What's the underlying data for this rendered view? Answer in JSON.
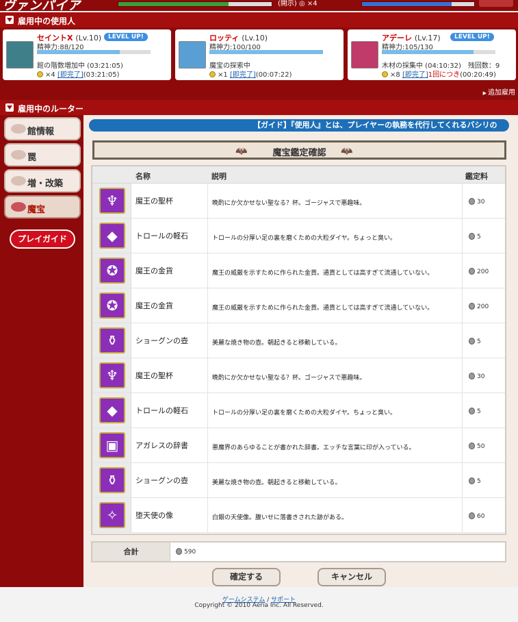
{
  "topbar": {
    "logo": "ヴァンパイア",
    "middle_text": "(開示) ◎ ×4"
  },
  "servants_header": {
    "title": "雇用中の使用人"
  },
  "servants": [
    {
      "name": "セイントX",
      "level": "(Lv.10)",
      "level_up": "LEVEL UP!",
      "stamina": "精神力:88/120",
      "stamina_ratio": 0.73,
      "task": "館の階数増加中 (03:21:05)",
      "coins": "×4",
      "complete": "[即完了]",
      "time": "(03:21:05)",
      "extra": "",
      "extra_red": "",
      "extra_time": "",
      "portrait_color": "#3f7f8a"
    },
    {
      "name": "ロッティ",
      "level": "(Lv.10)",
      "level_up": "",
      "stamina": "精神力:100/100",
      "stamina_ratio": 1.0,
      "task": "魔宝の探索中",
      "coins": "×1",
      "complete": "[即完了]",
      "time": "(00:07:22)",
      "extra": "",
      "extra_red": "",
      "extra_time": "",
      "portrait_color": "#5a9fd4"
    },
    {
      "name": "アデーレ",
      "level": "(Lv.17)",
      "level_up": "LEVEL UP!",
      "stamina": "精神力:105/130",
      "stamina_ratio": 0.81,
      "task": "木材の採集中 (04:10:32)　残回数：9",
      "coins": "×8",
      "complete": "[即完了]",
      "time": "",
      "extra": "",
      "extra_red": "1回につき",
      "extra_time": "(00:20:49)",
      "portrait_color": "#c03a6a"
    }
  ],
  "add_hire": "追加雇用",
  "looter_header": {
    "title": "雇用中のルーター"
  },
  "nav": [
    {
      "label": "館情報",
      "active": false
    },
    {
      "label": "罠",
      "active": false
    },
    {
      "label": "増・改築",
      "active": false
    },
    {
      "label": "魔宝",
      "active": true
    }
  ],
  "play_guide": "プレイガイド",
  "marquee": "【ガイド】『使用人』とは、プレイヤーの執務を代行してくれるバシリの",
  "panel_title": "魔宝鑑定確認",
  "table": {
    "headers": {
      "name": "名称",
      "desc": "説明",
      "fee": "鑑定料"
    },
    "rows": [
      {
        "icon": "grail-icon",
        "glyph": "♆",
        "name": "魔王の聖杯",
        "desc": "晩酌にか欠かせない聖なる？杯。ゴージャスで悪趣味。",
        "fee": "30"
      },
      {
        "icon": "gem-icon",
        "glyph": "◆",
        "name": "トロールの軽石",
        "desc": "トロールの分厚い足の裏を磨くための大粒ダイヤ。ちょっと臭い。",
        "fee": "5"
      },
      {
        "icon": "gold-coin-icon",
        "glyph": "✪",
        "name": "魔王の金貨",
        "desc": "魔王の威厳を示すために作られた金貨。通貨としては高すぎて流通していない。",
        "fee": "200"
      },
      {
        "icon": "gold-coin-icon",
        "glyph": "✪",
        "name": "魔王の金貨",
        "desc": "魔王の威厳を示すために作られた金貨。通貨としては高すぎて流通していない。",
        "fee": "200"
      },
      {
        "icon": "vase-icon",
        "glyph": "⚱",
        "name": "ショーグンの壺",
        "desc": "美麗な焼き物の壺。朝起きると移動している。",
        "fee": "5"
      },
      {
        "icon": "grail-icon",
        "glyph": "♆",
        "name": "魔王の聖杯",
        "desc": "晩酌にか欠かせない聖なる？杯。ゴージャスで悪趣味。",
        "fee": "30"
      },
      {
        "icon": "gem-icon",
        "glyph": "◆",
        "name": "トロールの軽石",
        "desc": "トロールの分厚い足の裏を磨くための大粒ダイヤ。ちょっと臭い。",
        "fee": "5"
      },
      {
        "icon": "book-icon",
        "glyph": "▣",
        "name": "アガレスの辞書",
        "desc": "悪魔界のあらゆることが書かれた辞書。エッチな言葉に印が入っている。",
        "fee": "50"
      },
      {
        "icon": "vase-icon",
        "glyph": "⚱",
        "name": "ショーグンの壺",
        "desc": "美麗な焼き物の壺。朝起きると移動している。",
        "fee": "5"
      },
      {
        "icon": "angel-statue-icon",
        "glyph": "✧",
        "name": "堕天使の像",
        "desc": "白銀の天使像。腹いせに落書きされた跡がある。",
        "fee": "60"
      }
    ]
  },
  "total": {
    "label": "合計",
    "value": "590"
  },
  "buttons": {
    "confirm": "確定する",
    "cancel": "キャンセル"
  },
  "footer": {
    "link1": "ゲームシステム",
    "sep": " / ",
    "link2": "サポート",
    "copyright": "Copyright © 2010 Aeria Inc. All Reserved."
  }
}
